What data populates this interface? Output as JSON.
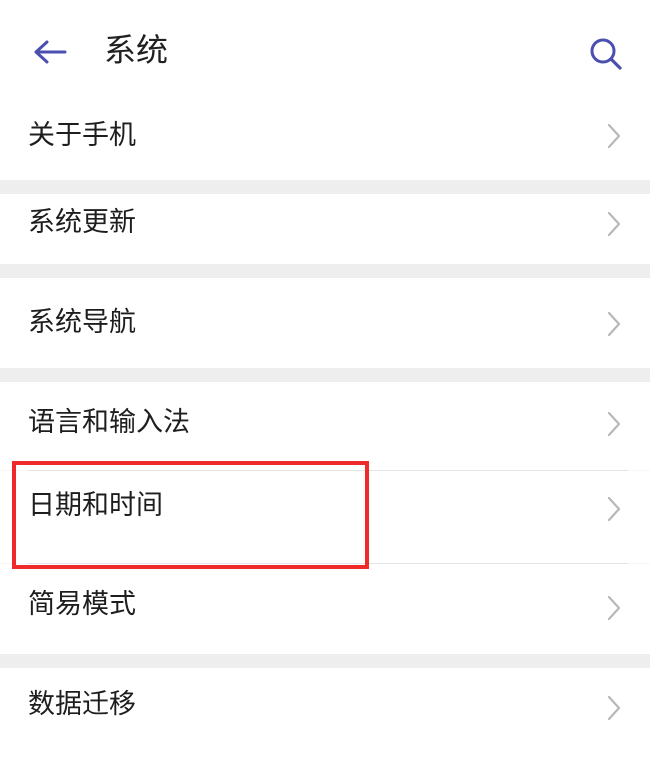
{
  "header": {
    "title": "系统",
    "back_icon": "back-arrow-icon",
    "search_icon": "search-icon",
    "accent_color": "#4a4fb0"
  },
  "menu": {
    "items": [
      {
        "label": "关于手机",
        "icon": "chevron-right-icon"
      },
      {
        "label": "系统更新",
        "icon": "chevron-right-icon"
      },
      {
        "label": "系统导航",
        "icon": "chevron-right-icon"
      },
      {
        "label": "语言和输入法",
        "icon": "chevron-right-icon"
      },
      {
        "label": "日期和时间",
        "icon": "chevron-right-icon"
      },
      {
        "label": "简易模式",
        "icon": "chevron-right-icon"
      },
      {
        "label": "数据迁移",
        "icon": "chevron-right-icon"
      }
    ]
  },
  "annotation": {
    "highlight_color": "#ee2a2a"
  }
}
